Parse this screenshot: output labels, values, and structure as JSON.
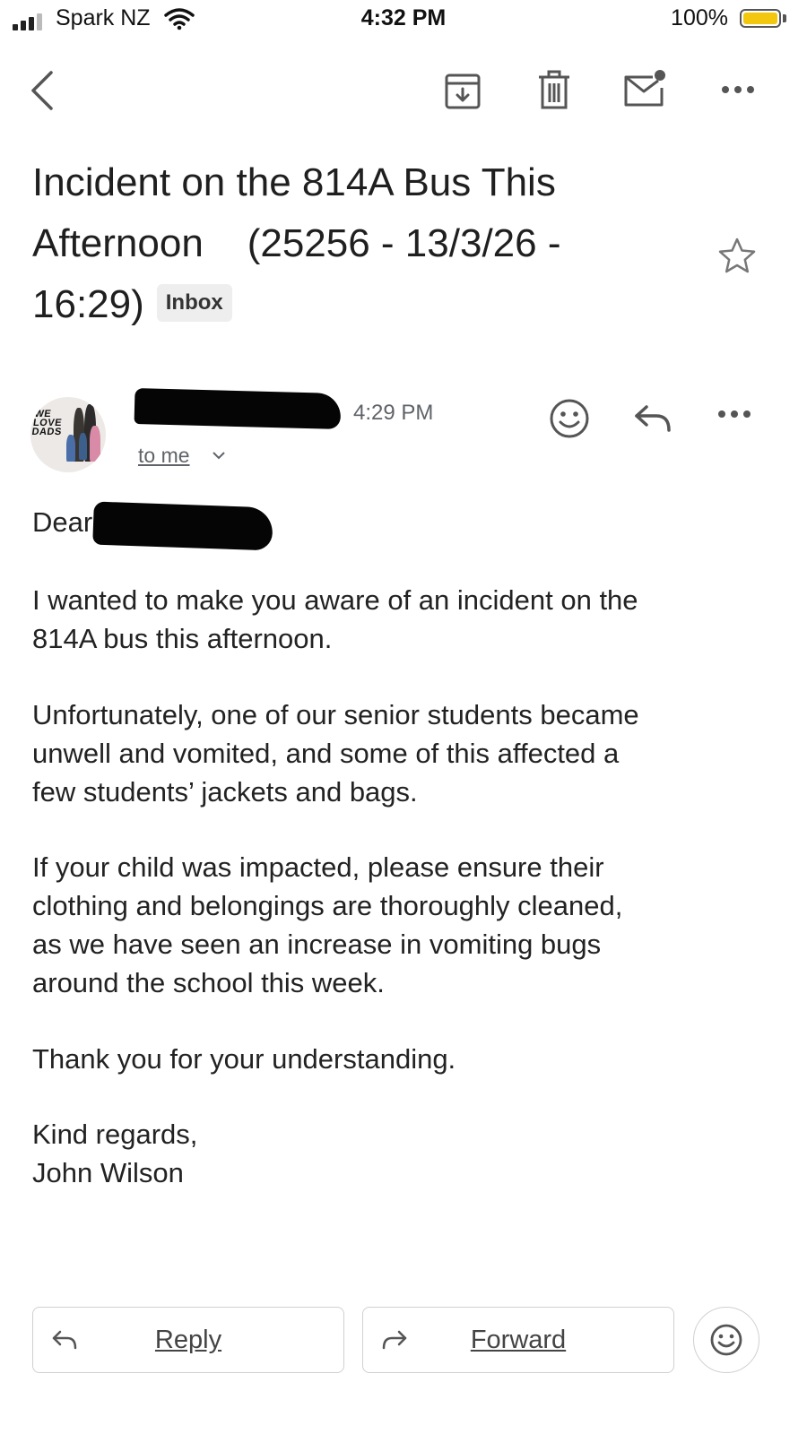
{
  "status_bar": {
    "carrier": "Spark NZ",
    "time": "4:32 PM",
    "battery_percent": "100%",
    "battery_level": 1.0,
    "signal_bars_filled": 3,
    "signal_bars_total": 4
  },
  "toolbar": {
    "icons": [
      "back-arrow-icon",
      "archive-icon",
      "delete-icon",
      "mark-unread-icon",
      "more-icon"
    ]
  },
  "email": {
    "subject_lines": [
      "Incident on the 814A Bus This",
      "Afternoon    (25256 - 13/3/26 -",
      "16:29)"
    ],
    "label_chip": "Inbox",
    "starred": false,
    "sender": {
      "avatar_text": "WE LOVE DADS",
      "time": "4:29 PM",
      "recipient": "to me"
    },
    "greeting": "Dear",
    "paragraphs": [
      [
        "I wanted to make you aware of an incident on the",
        "814A bus this afternoon."
      ],
      [
        "Unfortunately, one of our senior students became",
        "unwell and vomited, and some of this affected a",
        "few students’ jackets and bags."
      ],
      [
        "If your child was impacted, please ensure their",
        "clothing and belongings are thoroughly cleaned,",
        "as we have seen an increase in vomiting bugs",
        "around the school this week."
      ],
      [
        "Thank you for your understanding."
      ],
      [
        "Kind regards,",
        "John Wilson"
      ]
    ]
  },
  "actions": {
    "reply_label": "Reply",
    "forward_label": "Forward"
  },
  "colors": {
    "battery": "#f2c70e",
    "text": "#222222",
    "secondary": "#5f6368",
    "chip_bg": "#eeeeee"
  }
}
